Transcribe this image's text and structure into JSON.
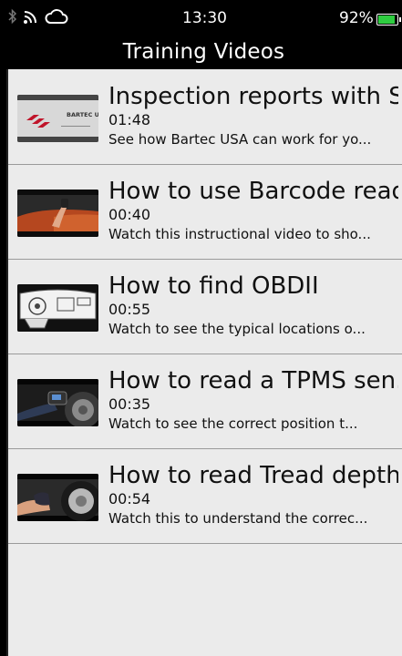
{
  "status_bar": {
    "time": "13:30",
    "battery_percent": "92%",
    "battery_level": 0.92,
    "icons": [
      "bluetooth-icon",
      "wifi-icon",
      "cloud-icon"
    ],
    "battery_color": "#2ecc40"
  },
  "header": {
    "title": "Training Videos"
  },
  "colors": {
    "header_bg": "#000000",
    "list_bg": "#ebebeb",
    "divider": "#9a9a9a"
  },
  "videos": [
    {
      "title": "Inspection reports with S...",
      "duration": "01:48",
      "description": "See how Bartec USA can work for yo...",
      "thumbnail": "bartec-logo",
      "thumb_logo_text": "BARTEC USA"
    },
    {
      "title": "How to use Barcode reader",
      "duration": "00:40",
      "description": "Watch this instructional video to sho...",
      "thumbnail": "car-interior-photo"
    },
    {
      "title": "How to find OBDII",
      "duration": "00:55",
      "description": "Watch to see the typical locations o...",
      "thumbnail": "dashboard-diagram"
    },
    {
      "title": "How to read a TPMS sen...",
      "duration": "00:35",
      "description": "Watch to see the correct position t...",
      "thumbnail": "tpms-tool-photo"
    },
    {
      "title": "How to read Tread depth",
      "duration": "00:54",
      "description": "Watch this to understand the correc...",
      "thumbnail": "tire-tread-photo"
    }
  ]
}
